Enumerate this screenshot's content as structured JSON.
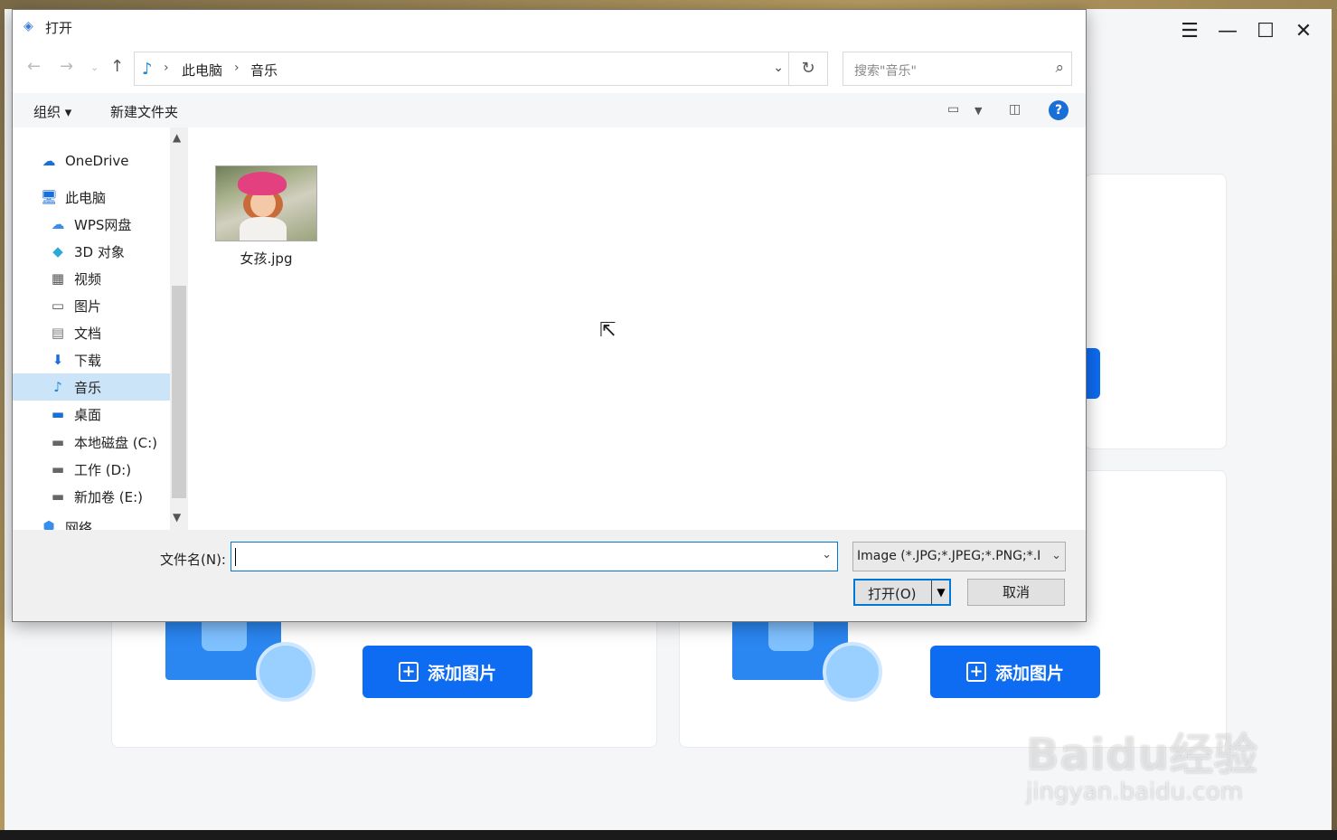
{
  "dialog": {
    "title": "打开",
    "address": {
      "crumbs": [
        "此电脑",
        "音乐"
      ],
      "search_placeholder": "搜索\"音乐\""
    },
    "toolbar": {
      "organize": "组织 ▾",
      "new_folder": "新建文件夹"
    },
    "nav": [
      {
        "label": "OneDrive",
        "icon": "cloud-icon",
        "glyph": "☁"
      },
      {
        "label": "此电脑",
        "icon": "computer-icon",
        "glyph": "🖥"
      },
      {
        "label": "WPS网盘",
        "icon": "cloud-icon",
        "glyph": "☁"
      },
      {
        "label": "3D 对象",
        "icon": "cube-icon",
        "glyph": "◆"
      },
      {
        "label": "视频",
        "icon": "film-icon",
        "glyph": "▦"
      },
      {
        "label": "图片",
        "icon": "picture-icon",
        "glyph": "▭"
      },
      {
        "label": "文档",
        "icon": "document-icon",
        "glyph": "▤"
      },
      {
        "label": "下载",
        "icon": "download-icon",
        "glyph": "⬇"
      },
      {
        "label": "音乐",
        "icon": "music-icon",
        "glyph": "♪",
        "selected": true
      },
      {
        "label": "桌面",
        "icon": "desktop-icon",
        "glyph": "▬"
      },
      {
        "label": "本地磁盘 (C:)",
        "icon": "drive-icon",
        "glyph": "▬"
      },
      {
        "label": "工作 (D:)",
        "icon": "drive-icon",
        "glyph": "▬"
      },
      {
        "label": "新加卷 (E:)",
        "icon": "drive-icon",
        "glyph": "▬"
      },
      {
        "label": "网络",
        "icon": "network-icon",
        "glyph": "⬢"
      }
    ],
    "files": [
      {
        "name": "女孩.jpg"
      }
    ],
    "bottom": {
      "filename_label": "文件名(N):",
      "filename_value": "",
      "filter": "Image (*.JPG;*.JPEG;*.PNG;*.I",
      "open": "打开(O)",
      "cancel": "取消"
    }
  },
  "app": {
    "add_image_label": "添加图片"
  },
  "watermark": {
    "line1": "Baidu经验",
    "line2": "jingyan.baidu.com"
  }
}
